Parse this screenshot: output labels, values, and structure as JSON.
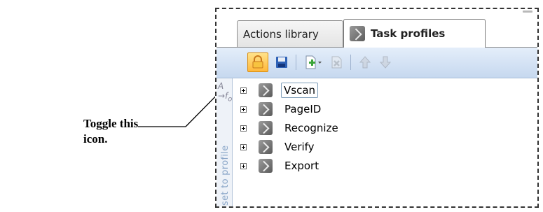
{
  "callout": {
    "line1": "Toggle this",
    "line2": "icon."
  },
  "tabs": [
    {
      "label": "Actions library",
      "active": false
    },
    {
      "label": "Task profiles",
      "active": true
    }
  ],
  "toolbar": {
    "buttons": [
      {
        "name": "lock-icon",
        "highlighted": true
      },
      {
        "name": "save-icon"
      },
      {
        "name": "new-profile-icon",
        "has_dropdown": true
      },
      {
        "name": "delete-icon",
        "disabled": true
      },
      {
        "name": "move-up-icon",
        "disabled": true
      },
      {
        "name": "move-down-icon",
        "disabled": true
      }
    ]
  },
  "side_panel": {
    "label": "set to profile"
  },
  "tree": {
    "items": [
      {
        "label": "Vscan",
        "selected": true
      },
      {
        "label": "PageID"
      },
      {
        "label": "Recognize"
      },
      {
        "label": "Verify"
      },
      {
        "label": "Export"
      }
    ]
  },
  "colors": {
    "accent": "#ffb83a",
    "toolbar": "#c6d8ef"
  }
}
